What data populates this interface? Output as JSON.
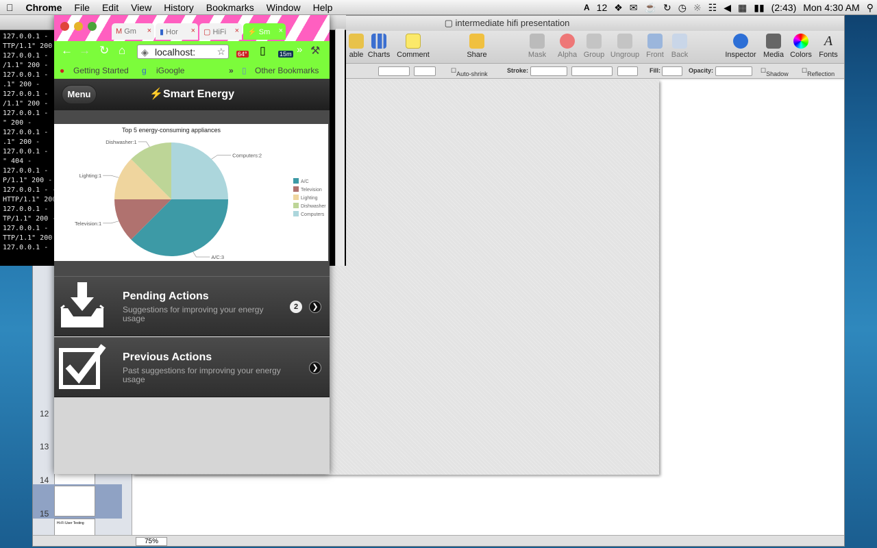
{
  "menubar": {
    "app_name": "Chrome",
    "menus": [
      "File",
      "Edit",
      "View",
      "History",
      "Bookmarks",
      "Window",
      "Help"
    ],
    "status_items": [
      "12",
      "(2:43)",
      "Mon 4:30 AM"
    ]
  },
  "terminal": {
    "lines": [
      "127.0.0.1 -",
      "TTP/1.1\" 200",
      "127.0.0.1 -",
      "/1.1\" 200 -",
      "127.0.0.1 -",
      ".1\" 200 -",
      "127.0.0.1 -",
      "/1.1\" 200 -",
      "127.0.0.1 -",
      "\" 200 -",
      "127.0.0.1 -",
      ".1\" 200 -",
      "127.0.0.1 -",
      "\" 404 -",
      "127.0.0.1 -",
      "P/1.1\" 200 -",
      "127.0.0.1 - -",
      "HTTP/1.1\" 200",
      "127.0.0.1 -",
      "TP/1.1\" 200 -",
      "127.0.0.1 -",
      "TTP/1.1\" 200",
      "127.0.0.1 -"
    ]
  },
  "keynote": {
    "title": "intermediate hifi presentation",
    "toolbar": [
      {
        "label": "able",
        "icon": "table-icon"
      },
      {
        "label": "Charts",
        "icon": "charts-icon"
      },
      {
        "label": "Comment",
        "icon": "comment-icon"
      },
      {
        "label": "Share",
        "icon": "share-icon"
      },
      {
        "label": "Mask",
        "icon": "mask-icon"
      },
      {
        "label": "Alpha",
        "icon": "alpha-icon"
      },
      {
        "label": "Group",
        "icon": "group-icon"
      },
      {
        "label": "Ungroup",
        "icon": "ungroup-icon"
      },
      {
        "label": "Front",
        "icon": "front-icon"
      },
      {
        "label": "Back",
        "icon": "back-icon"
      },
      {
        "label": "Inspector",
        "icon": "inspector-icon"
      },
      {
        "label": "Media",
        "icon": "media-icon"
      },
      {
        "label": "Colors",
        "icon": "colors-icon"
      },
      {
        "label": "Fonts",
        "icon": "fonts-icon"
      }
    ],
    "format_bar": {
      "auto_shrink": "Auto-shrink",
      "stroke": "Stroke:",
      "fill": "Fill:",
      "opacity": "Opacity:",
      "shadow": "Shadow",
      "reflection": "Reflection"
    },
    "slide_numbers": [
      "12",
      "13",
      "14",
      "15"
    ],
    "thumb_text": "Hi-Fi User Testing",
    "zoom": "75%"
  },
  "chrome": {
    "tabs": [
      {
        "label": "Gm",
        "icon": "gmail-icon"
      },
      {
        "label": "Hor",
        "icon": "docs-icon"
      },
      {
        "label": "HiFi",
        "icon": "slides-icon"
      },
      {
        "label": "Sm",
        "icon": "lightning-icon"
      }
    ],
    "url": "localhost:",
    "extensions": {
      "weather_temp": "64°",
      "timer": "15m"
    },
    "bookmarks": [
      "Getting Started",
      "iGoogle",
      "Other Bookmarks"
    ]
  },
  "app": {
    "menu_label": "Menu",
    "title": "Smart Energy",
    "rows": [
      {
        "title": "Pending Actions",
        "subtitle": "Suggestions for improving your energy usage",
        "badge": "2",
        "icon": "inbox-download-icon"
      },
      {
        "title": "Previous Actions",
        "subtitle": "Past suggestions for improving your energy usage",
        "badge": "",
        "icon": "checkbox-icon"
      }
    ]
  },
  "chart_data": {
    "type": "pie",
    "title": "Top 5 energy-consuming appliances",
    "categories": [
      "A/C",
      "Television",
      "Lighting",
      "Dishwasher",
      "Computers"
    ],
    "values": [
      3,
      1,
      1,
      1,
      2
    ],
    "slice_labels": [
      "A/C:3",
      "Television:1",
      "Lighting:1",
      "Dishwasher:1",
      "Computers:2"
    ],
    "colors": [
      "#3d9aa6",
      "#b0726f",
      "#efd59e",
      "#bdd597",
      "#acd6dc"
    ],
    "legend_placement": "right"
  }
}
